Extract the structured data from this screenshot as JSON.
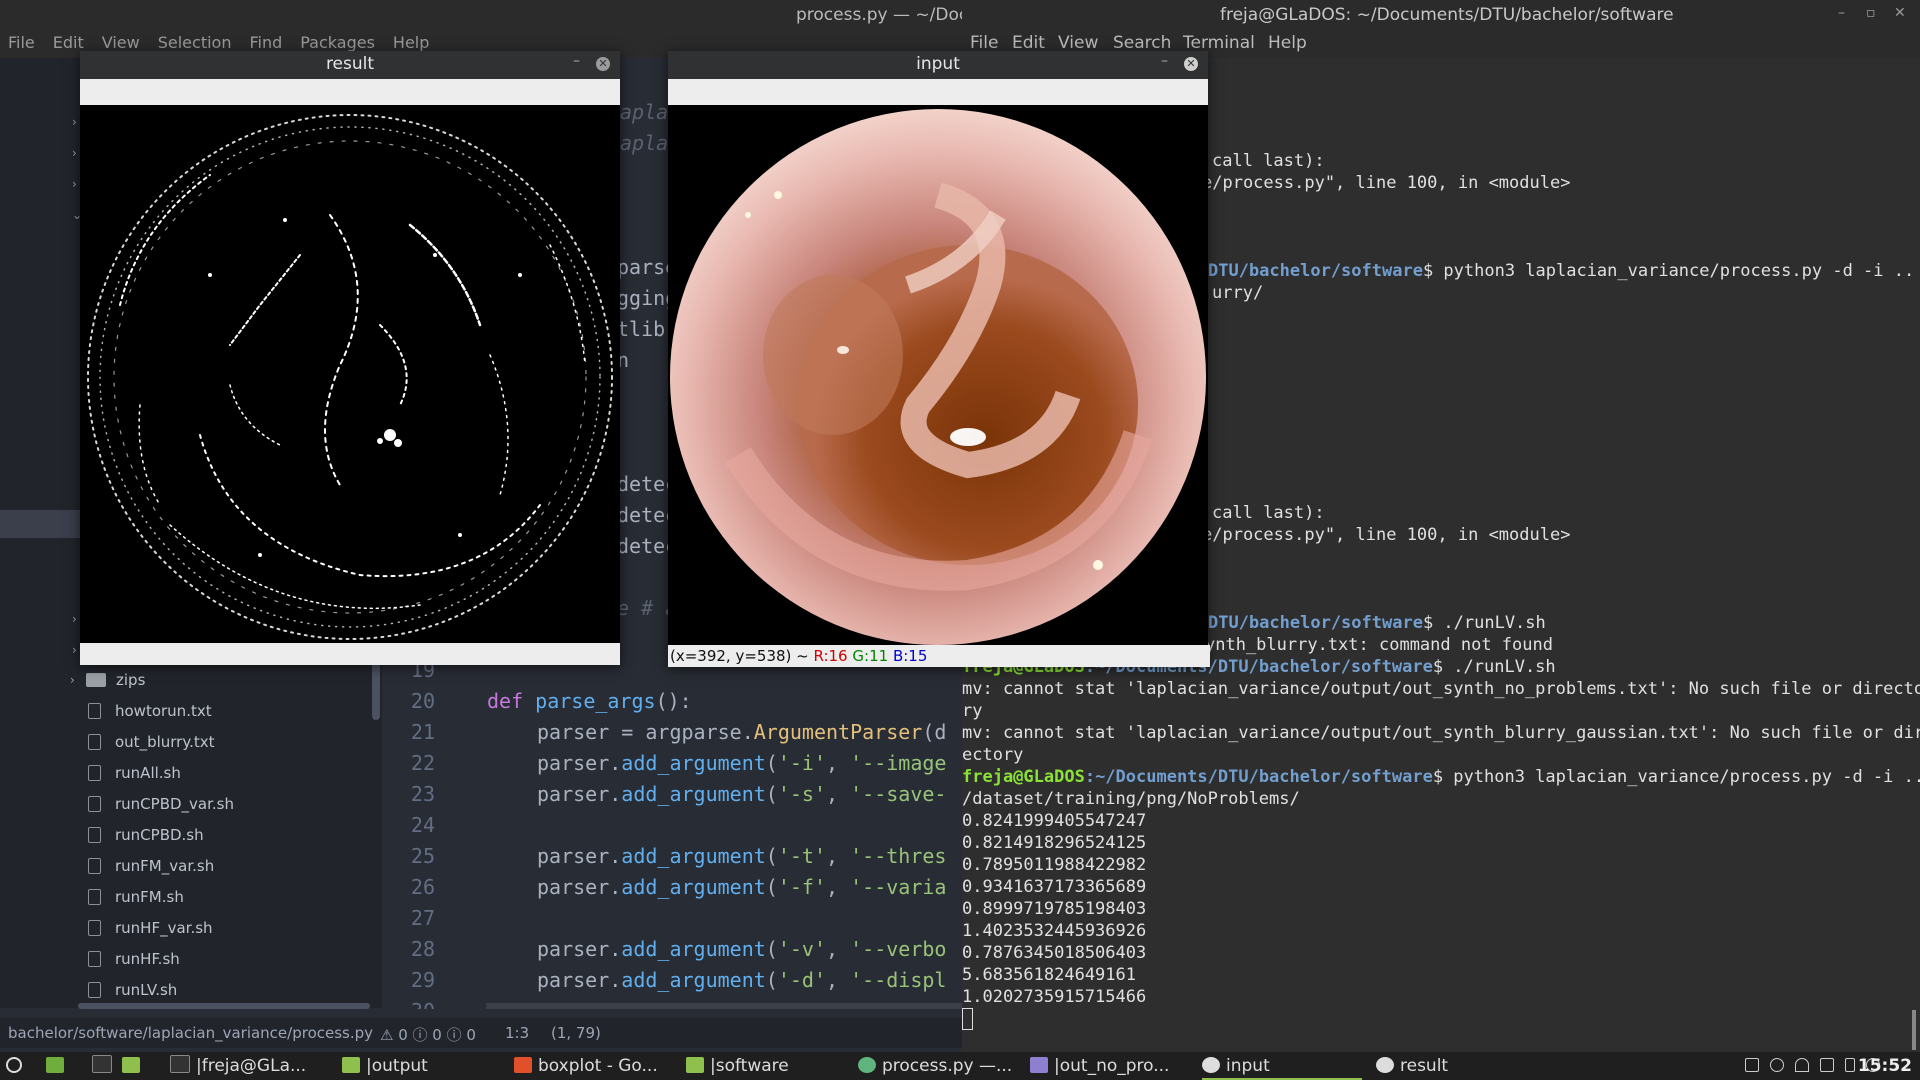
{
  "atom": {
    "title": "process.py — ~/Docu",
    "menu": [
      "File",
      "Edit",
      "View",
      "Selection",
      "Find",
      "Packages",
      "Help"
    ],
    "tree": [
      {
        "label": "zips",
        "type": "folder"
      },
      {
        "label": "howtorun.txt",
        "type": "file"
      },
      {
        "label": "out_blurry.txt",
        "type": "file"
      },
      {
        "label": "runAll.sh",
        "type": "file"
      },
      {
        "label": "runCPBD_var.sh",
        "type": "file"
      },
      {
        "label": "runCPBD.sh",
        "type": "file"
      },
      {
        "label": "runFM_var.sh",
        "type": "file"
      },
      {
        "label": "runFM.sh",
        "type": "file"
      },
      {
        "label": "runHF_var.sh",
        "type": "file"
      },
      {
        "label": "runHF.sh",
        "type": "file"
      },
      {
        "label": "runLV.sh",
        "type": "file"
      }
    ],
    "partial_lines": [
      "apla",
      "apla",
      "parse",
      "gging",
      "tlib",
      "n",
      "detec",
      "detec",
      "detec",
      "e # a"
    ],
    "line_numbers": [
      "19",
      "20",
      "21",
      "22",
      "23",
      "24",
      "25",
      "26",
      "27",
      "28",
      "29",
      "30"
    ],
    "code": {
      "l20_kw": "def",
      "l20_fn": "parse_args",
      "l20_rest": "():",
      "l21_a": "parser = argparse.",
      "l21_cls": "ArgumentParser",
      "l21_b": "(d",
      "l22_a": "parser.",
      "l22_fn": "add_argument",
      "l22_s1": "'-i'",
      "l22_s2": "'--image",
      "l23_s1": "'-s'",
      "l23_s2": "'--save-",
      "l25_s1": "'-t'",
      "l25_s2": "'--thres",
      "l26_s1": "'-f'",
      "l26_s2": "'--varia",
      "l28_s1": "'-v'",
      "l28_s2": "'--verbo",
      "l29_s1": "'-d'",
      "l29_s2": "'--displ",
      "comma": ", "
    },
    "status": {
      "path": "bachelor/software/laplacian_variance/process.py",
      "problems": "⚠ 0 ⓘ 0 ⓘ 0",
      "cursor": "1:3",
      "selection": "(1, 79)"
    }
  },
  "terminal": {
    "title": "freja@GLaDOS: ~/Documents/DTU/bachelor/software",
    "menu": [
      "File",
      "Edit",
      "View",
      "Search",
      "Terminal",
      "Help"
    ],
    "lines": {
      "t1": "call last):",
      "t2": "e/process.py\", line 100, in <module>",
      "t3_path": "DTU/bachelor/software",
      "t3_cmd": "$ python3 laplacian_variance/process.py -d -i ..",
      "t4": "urry/",
      "t5": "call last):",
      "t6": "e/process.py\", line 100, in <module>",
      "t7_path": "DTU/bachelor/software",
      "t7_cmd": "$ ./runLV.sh",
      "t8": "ynth_blurry.txt: command not found",
      "t9_user": "freja@GLaDOS",
      "t9_path": ":~/Documents/DTU/bachelor/software",
      "t9_cmd": "$ ./runLV.sh",
      "t10": "mv: cannot stat 'laplacian_variance/output/out_synth_no_problems.txt': No such file or directo",
      "t11": "ry",
      "t12": "mv: cannot stat 'laplacian_variance/output/out_synth_blurry_gaussian.txt': No such file or dir",
      "t13": "ectory",
      "t14_user": "freja@GLaDOS",
      "t14_path": ":~/Documents/DTU/bachelor/software",
      "t14_cmd": "$ python3 laplacian_variance/process.py -d -i ..",
      "t15": "/dataset/training/png/NoProblems/"
    },
    "values": [
      "0.8241999405547247",
      "0.8214918296524125",
      "0.7895011988422982",
      "0.9341637173365689",
      "0.8999719785198403",
      "1.4023532445936926",
      "0.7876345018506403",
      "5.683561824649161",
      "1.0202735915715466"
    ]
  },
  "windows": {
    "result_title": "result",
    "input_title": "input",
    "input_status_coords": "(x=392, y=538) ~ ",
    "input_r": "R:16",
    "input_g": "G:11",
    "input_b": "B:15"
  },
  "taskbar": {
    "items": [
      "|freja@GLa...",
      "|output",
      "boxplot - Go...",
      "|software",
      "process.py —...",
      "|out_no_pro...",
      "input",
      "result"
    ],
    "clock": "15:52"
  },
  "colors": {
    "prompt_user": "#8ae234",
    "prompt_path": "#729fcf",
    "keyword": "#c678dd",
    "function": "#61afef",
    "string": "#98c379",
    "class": "#e5c07b"
  }
}
